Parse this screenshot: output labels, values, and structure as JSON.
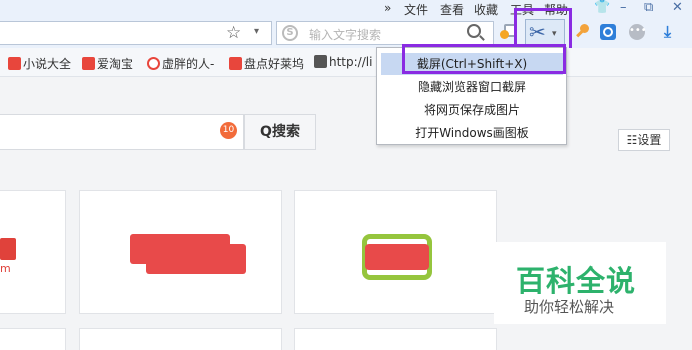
{
  "menubar": {
    "expand": "»",
    "items": [
      "文件",
      "查看",
      "收藏",
      "工具",
      "帮助"
    ],
    "controls": {
      "skin": "👕",
      "minimize": "–",
      "maximize": "⧉",
      "close": "✕"
    }
  },
  "addressbar": {
    "star": "☆",
    "dropdown": "▾"
  },
  "search": {
    "engine_glyph": "S",
    "placeholder": "输入文字搜索"
  },
  "toolbar": {
    "cut_glyph": "✂",
    "cut_dropdown": "▾",
    "more_glyph": "•••",
    "download_glyph": "⤓"
  },
  "bookmarks": [
    {
      "label": "小说大全",
      "color": "#e8463c"
    },
    {
      "label": "爱淘宝",
      "color": "#e8463c"
    },
    {
      "label": "虚胖的人-",
      "color": "#e8463c"
    },
    {
      "label": "盘点好莱坞",
      "color": "#e8463c"
    },
    {
      "label": "http://li",
      "color": "#555555"
    }
  ],
  "dropdown": {
    "items": [
      "截屏(Ctrl+Shift+X)",
      "隐藏浏览器窗口截屏",
      "将网页保存成图片",
      "打开Windows画图板"
    ]
  },
  "homepage": {
    "hot_badge": "10",
    "search_button": "Q搜索",
    "settings_button": "☷设置",
    "tile1_text": "m"
  },
  "watermark": {
    "title": "百科全说",
    "subtitle": "助你轻松解决"
  },
  "colors": {
    "highlight_border": "#8a2be2",
    "accent": "#2f7fd9",
    "watermark_green": "#2db26c"
  }
}
